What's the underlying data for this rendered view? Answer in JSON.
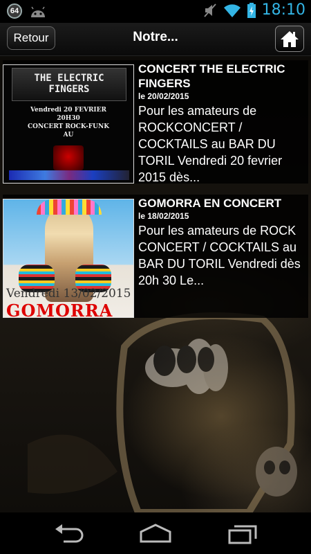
{
  "status_bar": {
    "badge": "64",
    "time": "18:10",
    "icons": [
      "android-icon",
      "mute-icon",
      "wifi-icon",
      "battery-icon"
    ]
  },
  "header": {
    "back_label": "Retour",
    "title": "Notre...",
    "home_icon": "home-icon"
  },
  "items": [
    {
      "title": "CONCERT THE ELECTRIC FINGERS",
      "date": "le 20/02/2015",
      "description": "Pour les amateurs de ROCKCONCERT / COCKTAILS au BAR DU TORIL Vendredi 20 fevrier 2015 dès...",
      "poster": {
        "heading": "THE ELECTRIC FINGERS",
        "line1": "Vendredi 20 FEVRIER",
        "line2": "20H30",
        "line3": "CONCERT ROCK-FUNK",
        "line4": "AU"
      }
    },
    {
      "title": "GOMORRA EN CONCERT",
      "date": "le 18/02/2015",
      "description": "Pour les amateurs de ROCK CONCERT / COCKTAILS au BAR DU TORIL Vendredi dès 20h 30 Le...",
      "poster": {
        "date_text": "Vendredi 13/02/2015",
        "name_text": "GOMORRA"
      }
    }
  ],
  "navbar": {
    "icons": [
      "back-icon",
      "home-nav-icon",
      "recent-apps-icon"
    ]
  }
}
